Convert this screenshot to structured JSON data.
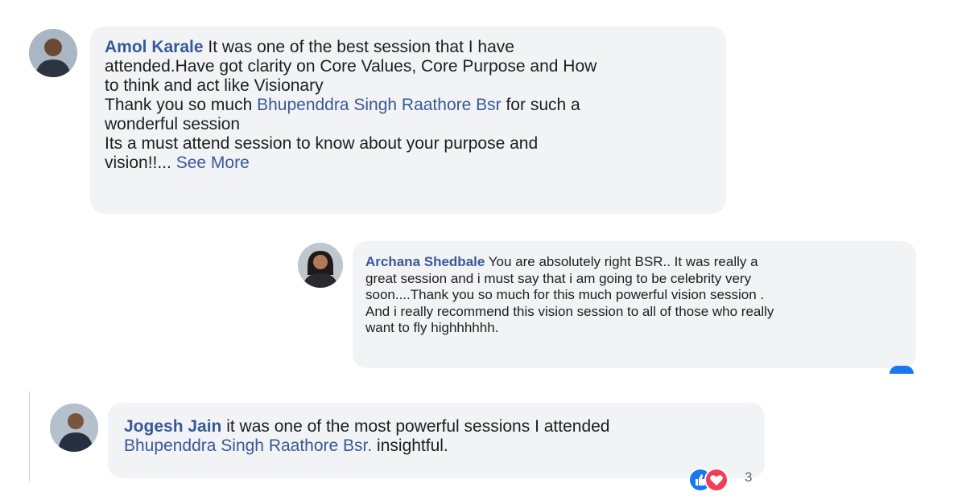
{
  "comments": [
    {
      "author": "Amol Karale",
      "lines": [
        " It was one of the best session that I have",
        "attended.Have got clarity on Core Values, Core Purpose and How",
        "to think and act like Visionary"
      ],
      "line4_pre": "Thank you so much ",
      "line4_mention": "Bhupenddra Singh Raathore Bsr",
      "line4_post": " for such a",
      "line5": "wonderful session",
      "line6": "Its a must attend session to know about your purpose and",
      "line7_pre": "vision!!... ",
      "see_more": "See More"
    },
    {
      "author": "Archana Shedbale",
      "line1": " You are absolutely right BSR.. It was really a",
      "line2": "great session and i must say that i am going to be celebrity very",
      "line3": "soon....Thank you so much for this much powerful vision session .",
      "line4": "And i really recommend this vision session to all of those who really",
      "line5": "want to fly highhhhhh."
    },
    {
      "author": "Jogesh Jain",
      "line1": " it was one of the most powerful sessions I attended",
      "mention": "Bhupenddra Singh Raathore Bsr.",
      "line2_post": " insightful.",
      "reaction_count": "3",
      "reactions": [
        "like-icon",
        "love-icon"
      ]
    }
  ],
  "colors": {
    "bubble": "#f2f3f5",
    "link": "#385898",
    "like": "#1877f2",
    "love": "#f33e58"
  }
}
